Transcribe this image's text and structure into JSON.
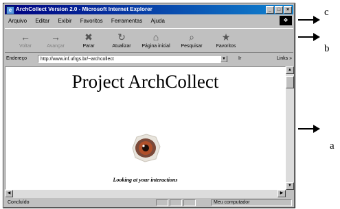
{
  "window": {
    "title": "ArchCollect Version 2.0 - Microsoft Internet Explorer",
    "controls": [
      "_",
      "□",
      "×"
    ]
  },
  "menu": [
    "Arquivo",
    "Editar",
    "Exibir",
    "Favoritos",
    "Ferramentas",
    "Ajuda"
  ],
  "toolbar": [
    {
      "label": "Voltar",
      "icon": "back-arrow-icon",
      "glyph": "←"
    },
    {
      "label": "Avançar",
      "icon": "forward-arrow-icon",
      "glyph": "→"
    },
    {
      "label": "Parar",
      "icon": "stop-icon",
      "glyph": "✖"
    },
    {
      "label": "Atualizar",
      "icon": "refresh-icon",
      "glyph": "↻"
    },
    {
      "label": "Página inicial",
      "icon": "home-icon",
      "glyph": "⌂"
    },
    {
      "label": "Pesquisar",
      "icon": "search-icon",
      "glyph": "⌕"
    },
    {
      "label": "Favoritos",
      "icon": "favorites-icon",
      "glyph": "★"
    }
  ],
  "address": {
    "label": "Endereço",
    "url": "http://www.inf.ufrgs.br/~archcollect",
    "go_label": "Ir",
    "links_label": "Links »"
  },
  "page": {
    "heading": "Project ArchCollect",
    "tagline": "Looking at your interactions"
  },
  "status": {
    "left": "Concluído",
    "right": "Meu computador"
  },
  "annotations": {
    "c": "c",
    "b": "b",
    "a": "a"
  }
}
